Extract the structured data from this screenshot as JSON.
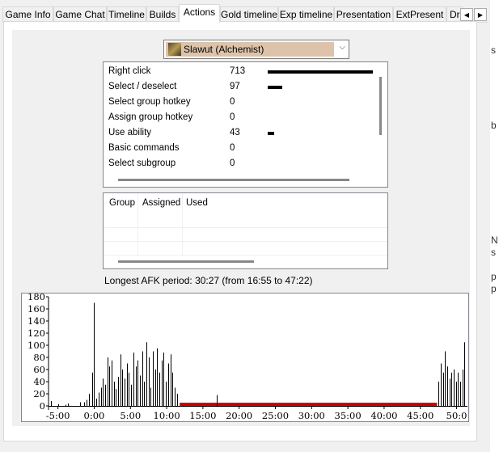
{
  "tabs": {
    "items": [
      {
        "label": "Game Info"
      },
      {
        "label": "Game Chat"
      },
      {
        "label": "Timeline"
      },
      {
        "label": "Builds"
      },
      {
        "label": "Actions"
      },
      {
        "label": "Gold timeline"
      },
      {
        "label": "Exp timeline"
      },
      {
        "label": "Presentation"
      },
      {
        "label": "ExtPresent"
      },
      {
        "label": "Dra"
      }
    ],
    "active": "Actions",
    "scroll_left": "◀",
    "scroll_right": "▶"
  },
  "player_select": {
    "selected": "Slawut (Alchemist)",
    "arrow": "⌵"
  },
  "actions": {
    "rows": [
      {
        "label": "Right click",
        "value": "713",
        "bar": 713
      },
      {
        "label": "Select / deselect",
        "value": "97",
        "bar": 97
      },
      {
        "label": "Select group hotkey",
        "value": "0",
        "bar": 0
      },
      {
        "label": "Assign group hotkey",
        "value": "0",
        "bar": 0
      },
      {
        "label": "Use ability",
        "value": "43",
        "bar": 43
      },
      {
        "label": "Basic commands",
        "value": "0",
        "bar": 0
      },
      {
        "label": "Select subgroup",
        "value": "0",
        "bar": 0
      }
    ],
    "bar_max": 713
  },
  "groups": {
    "headers": [
      "Group",
      "Assigned",
      "Used"
    ]
  },
  "afk": {
    "text": "Longest AFK period: 30:27 (from 16:55 to 47:22)"
  },
  "chart_data": {
    "type": "bar",
    "title": "",
    "xlabel": "",
    "ylabel": "",
    "y_ticks": [
      "180",
      "160",
      "140",
      "120",
      "100",
      "80",
      "60",
      "40",
      "20",
      "0"
    ],
    "x_ticks": [
      "-5:00",
      "0:00",
      "5:00",
      "10:00",
      "15:00",
      "20:00",
      "25:00",
      "30:00",
      "35:00",
      "40:00",
      "45:00",
      "50:0"
    ],
    "ylim": [
      0,
      180
    ],
    "xlim_minutes": [
      -6.3,
      51.5
    ],
    "afk_period_minutes": [
      11.8,
      47.3
    ],
    "afk_color": "#cc0000",
    "bar_color": "#000000",
    "series": [
      {
        "values_by_minute": [
          [
            -6,
            8
          ],
          [
            -5,
            3
          ],
          [
            -4,
            2
          ],
          [
            -3.6,
            4
          ],
          [
            -2,
            6
          ],
          [
            -1.4,
            6
          ],
          [
            -1.1,
            10
          ],
          [
            -0.7,
            20
          ],
          [
            -0.3,
            55
          ],
          [
            0,
            170
          ],
          [
            0.3,
            12
          ],
          [
            0.6,
            22
          ],
          [
            0.9,
            30
          ],
          [
            1.2,
            45
          ],
          [
            1.5,
            35
          ],
          [
            1.8,
            80
          ],
          [
            2.1,
            65
          ],
          [
            2.4,
            75
          ],
          [
            2.7,
            40
          ],
          [
            3,
            28
          ],
          [
            3.3,
            48
          ],
          [
            3.6,
            85
          ],
          [
            3.9,
            60
          ],
          [
            4.2,
            45
          ],
          [
            4.5,
            70
          ],
          [
            4.8,
            55
          ],
          [
            5.1,
            35
          ],
          [
            5.4,
            88
          ],
          [
            5.7,
            65
          ],
          [
            6,
            75
          ],
          [
            6.3,
            50
          ],
          [
            6.6,
            90
          ],
          [
            6.9,
            40
          ],
          [
            7.2,
            105
          ],
          [
            7.5,
            80
          ],
          [
            7.8,
            30
          ],
          [
            8.1,
            90
          ],
          [
            8.4,
            60
          ],
          [
            8.7,
            95
          ],
          [
            9,
            55
          ],
          [
            9.3,
            75
          ],
          [
            9.6,
            88
          ],
          [
            9.9,
            40
          ],
          [
            10.2,
            70
          ],
          [
            10.5,
            85
          ],
          [
            10.8,
            55
          ],
          [
            11.1,
            30
          ],
          [
            11.4,
            20
          ],
          [
            16.9,
            18
          ],
          [
            47.5,
            40
          ],
          [
            47.8,
            70
          ],
          [
            48.1,
            55
          ],
          [
            48.4,
            90
          ],
          [
            48.7,
            65
          ],
          [
            49,
            45
          ],
          [
            49.3,
            55
          ],
          [
            49.6,
            60
          ],
          [
            49.9,
            40
          ],
          [
            50.2,
            55
          ],
          [
            50.5,
            40
          ],
          [
            50.8,
            60
          ],
          [
            51.1,
            105
          ]
        ]
      }
    ]
  }
}
